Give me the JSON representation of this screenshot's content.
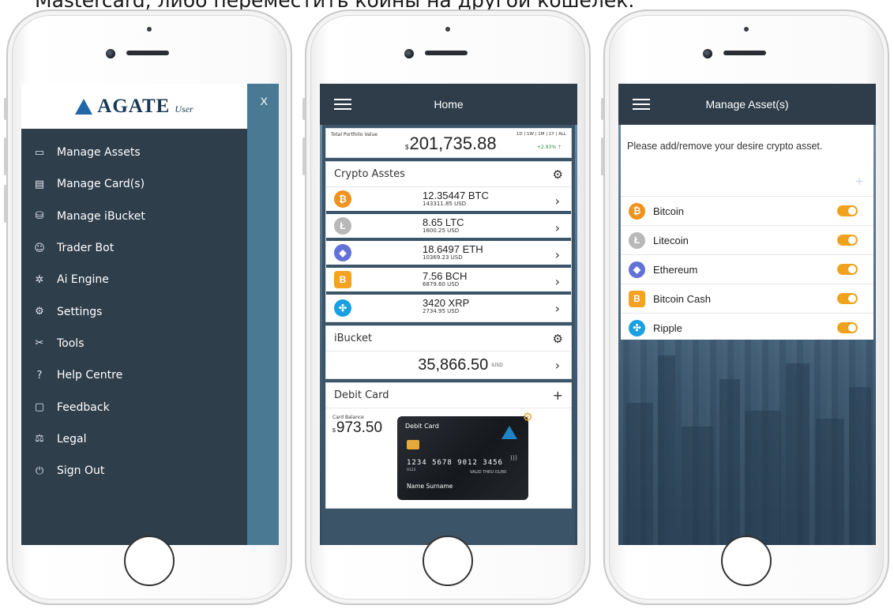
{
  "caption": "Mastercard, либо переместить коины на другой кошелёк.",
  "phone1": {
    "close_label": "X",
    "logo": {
      "text": "AGATE",
      "sub": "User"
    },
    "menu": [
      {
        "label": "Manage Assets",
        "icon": "wallet-icon"
      },
      {
        "label": "Manage Card(s)",
        "icon": "card-icon"
      },
      {
        "label": "Manage iBucket",
        "icon": "bucket-icon"
      },
      {
        "label": "Trader Bot",
        "icon": "robot-icon"
      },
      {
        "label": "Ai Engine",
        "icon": "network-icon"
      },
      {
        "label": "Settings",
        "icon": "gear-icon"
      },
      {
        "label": "Tools",
        "icon": "tools-icon"
      },
      {
        "label": "Help Centre",
        "icon": "help-icon"
      },
      {
        "label": "Feedback",
        "icon": "chat-icon"
      },
      {
        "label": "Legal",
        "icon": "scales-icon"
      },
      {
        "label": "Sign Out",
        "icon": "power-icon"
      }
    ]
  },
  "phone2": {
    "title": "Home",
    "portfolio": {
      "label": "Total Portfolio Value",
      "currency": "$",
      "value": "201,735.88",
      "ranges": "1D | 1W | 1M | 1Y | ALL",
      "change": "+2.93% ↑"
    },
    "crypto_section": "Crypto Asstes",
    "assets": [
      {
        "amount": "12.35447 BTC",
        "usd": "143311.85 USD",
        "color": "#f0921e",
        "glyph": "₿"
      },
      {
        "amount": "8.65 LTC",
        "usd": "1600.25 USD",
        "color": "#b8b8b8",
        "glyph": "Ł"
      },
      {
        "amount": "18.6497 ETH",
        "usd": "10369.23 USD",
        "color": "#6272d8",
        "glyph": "◆"
      },
      {
        "amount": "7.56 BCH",
        "usd": "6879.60 USD",
        "color": "#f4a21f",
        "glyph": "B"
      },
      {
        "amount": "3420 XRP",
        "usd": "2734.95 USD",
        "color": "#1aa0e0",
        "glyph": "✣"
      }
    ],
    "bucket_section": "iBucket",
    "bucket": {
      "value": "35,866.50",
      "currency": "iUSD"
    },
    "debit_section": "Debit Card",
    "debit_plus": "+",
    "card_balance": {
      "label": "Card Balance",
      "currency": "$",
      "value": "973.50"
    },
    "card": {
      "title": "Debit Card",
      "number": "1234 5678 9012 3456",
      "short": "0123",
      "expiry": "VALID THRU 01/80",
      "name": "Name Surname"
    }
  },
  "phone3": {
    "title": "Manage Asset(s)",
    "intro": "Please add/remove your desire crypto asset.",
    "plus": "+",
    "assets": [
      {
        "name": "Bitcoin",
        "color": "#f0921e",
        "glyph": "₿",
        "enabled": true
      },
      {
        "name": "Litecoin",
        "color": "#b8b8b8",
        "glyph": "Ł",
        "enabled": true
      },
      {
        "name": "Ethereum",
        "color": "#6272d8",
        "glyph": "◆",
        "enabled": true
      },
      {
        "name": "Bitcoin Cash",
        "color": "#f4a21f",
        "glyph": "B",
        "enabled": true
      },
      {
        "name": "Ripple",
        "color": "#1aa0e0",
        "glyph": "✣",
        "enabled": true
      }
    ]
  }
}
